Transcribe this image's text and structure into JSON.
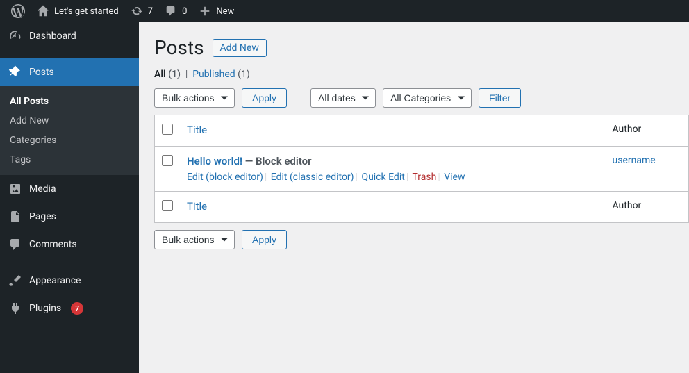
{
  "adminbar": {
    "site_name": "Let's get started",
    "updates": "7",
    "comments": "0",
    "new_label": "New"
  },
  "sidebar": {
    "dashboard": "Dashboard",
    "posts": "Posts",
    "submenu": {
      "all_posts": "All Posts",
      "add_new": "Add New",
      "categories": "Categories",
      "tags": "Tags"
    },
    "media": "Media",
    "pages": "Pages",
    "comments": "Comments",
    "appearance": "Appearance",
    "plugins": "Plugins",
    "plugins_badge": "7"
  },
  "page": {
    "title": "Posts",
    "add_new": "Add New"
  },
  "filters": {
    "all": "All",
    "all_count": "(1)",
    "published": "Published",
    "published_count": "(1)"
  },
  "actions": {
    "bulk": "Bulk actions",
    "apply": "Apply",
    "all_dates": "All dates",
    "all_categories": "All Categories",
    "filter": "Filter"
  },
  "table": {
    "title_header": "Title",
    "author_header": "Author",
    "row": {
      "title": "Hello world!",
      "state": " — Block editor",
      "author": "username",
      "actions": {
        "edit_block": "Edit (block editor)",
        "edit_classic": "Edit (classic editor)",
        "quick_edit": "Quick Edit",
        "trash": "Trash",
        "view": "View"
      }
    }
  }
}
